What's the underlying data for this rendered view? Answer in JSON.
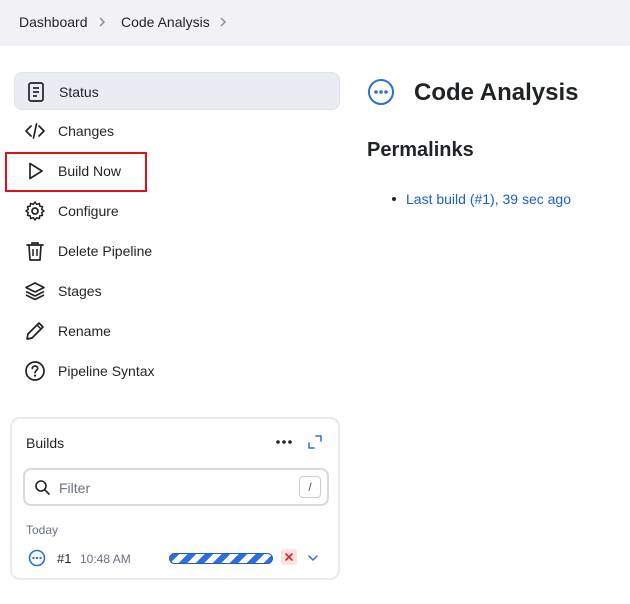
{
  "breadcrumb": {
    "items": [
      "Dashboard",
      "Code Analysis"
    ]
  },
  "sidebar": {
    "items": [
      {
        "label": "Status",
        "icon": "document-icon",
        "active": true
      },
      {
        "label": "Changes",
        "icon": "code-icon"
      },
      {
        "label": "Build Now",
        "icon": "play-icon",
        "highlighted": true
      },
      {
        "label": "Configure",
        "icon": "gear-icon"
      },
      {
        "label": "Delete Pipeline",
        "icon": "trash-icon"
      },
      {
        "label": "Stages",
        "icon": "layers-icon"
      },
      {
        "label": "Rename",
        "icon": "pencil-icon"
      },
      {
        "label": "Pipeline Syntax",
        "icon": "help-circle-icon"
      }
    ]
  },
  "builds": {
    "title": "Builds",
    "filter_placeholder": "Filter",
    "filter_shortcut": "/",
    "group_label": "Today",
    "rows": [
      {
        "number": "#1",
        "time": "10:48 AM",
        "status": "in-progress"
      }
    ]
  },
  "main": {
    "title": "Code Analysis",
    "permalinks_heading": "Permalinks",
    "permalinks": [
      "Last build (#1), 39 sec ago"
    ]
  },
  "colors": {
    "accent": "#2a6fdb",
    "link": "#1a5fc7",
    "highlight": "#e0101a",
    "active_bg": "#e9ecf2"
  }
}
